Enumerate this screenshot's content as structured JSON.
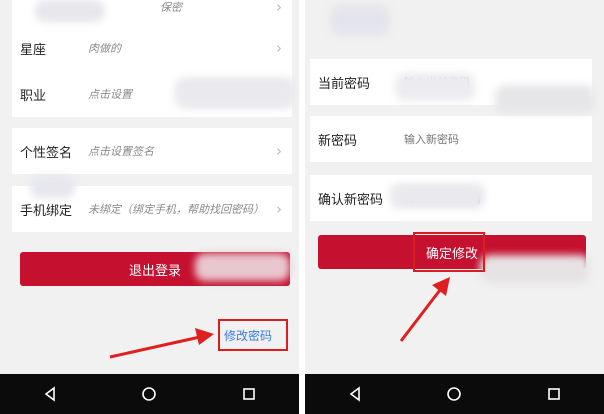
{
  "left_screen": {
    "rows": [
      {
        "label": "",
        "value": "保密"
      },
      {
        "label": "星座",
        "value": "肉做的"
      },
      {
        "label": "职业",
        "value": "点击设置"
      },
      {
        "label": "个性签名",
        "value": "点击设置签名"
      },
      {
        "label": "手机绑定",
        "value": "未绑定（绑定手机，帮助找回密码）"
      }
    ],
    "logout_label": "退出登录",
    "change_password_link": "修改密码"
  },
  "right_screen": {
    "fields": [
      {
        "label": "当前密码",
        "placeholder": "输入当前密码"
      },
      {
        "label": "新密码",
        "placeholder": "输入新密码"
      },
      {
        "label": "确认新密码",
        "placeholder": "再次输入新密码"
      }
    ],
    "confirm_label": "确定修改"
  },
  "navbar": {
    "icons": [
      "back-icon",
      "home-icon",
      "recents-icon"
    ]
  },
  "colors": {
    "accent": "#c5102f",
    "highlight_box": "#d81e1e",
    "arrow": "#e02020",
    "link": "#3a7be0"
  }
}
